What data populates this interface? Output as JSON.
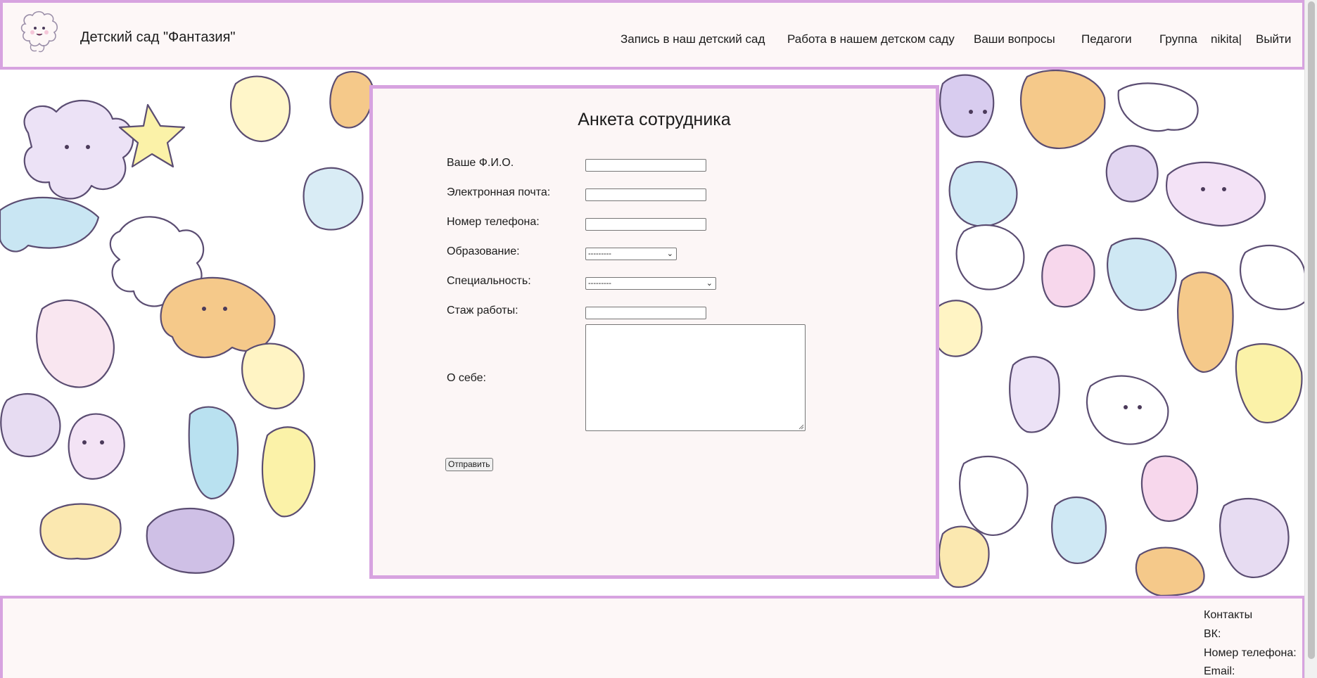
{
  "header": {
    "site_title": "Детский сад \"Фантазия\"",
    "nav": [
      {
        "label": "Запись в наш детский сад"
      },
      {
        "label": "Работа в нашем детском саду"
      },
      {
        "label": "Ваши вопросы"
      },
      {
        "label": "Педагоги"
      },
      {
        "label": "Группа"
      },
      {
        "label": "nikita|"
      },
      {
        "label": "Выйти"
      }
    ]
  },
  "form": {
    "title": "Анкета сотрудника",
    "fields": {
      "name_label": "Ваше Ф.И.О.",
      "email_label": "Электронная почта:",
      "phone_label": "Номер телефона:",
      "education_label": "Образование:",
      "education_value": "---------",
      "specialty_label": "Специальность:",
      "specialty_value": "---------",
      "experience_label": "Стаж работы:",
      "about_label": "О себе:"
    },
    "submit_label": "Отправить"
  },
  "footer": {
    "contacts_label": "Контакты",
    "vk_label": "ВК:",
    "phone_label": "Номер телефона:",
    "email_label": "Email:"
  },
  "colors": {
    "accent_border": "#d7a3e0",
    "panel_bg": "#fcf6f6"
  }
}
